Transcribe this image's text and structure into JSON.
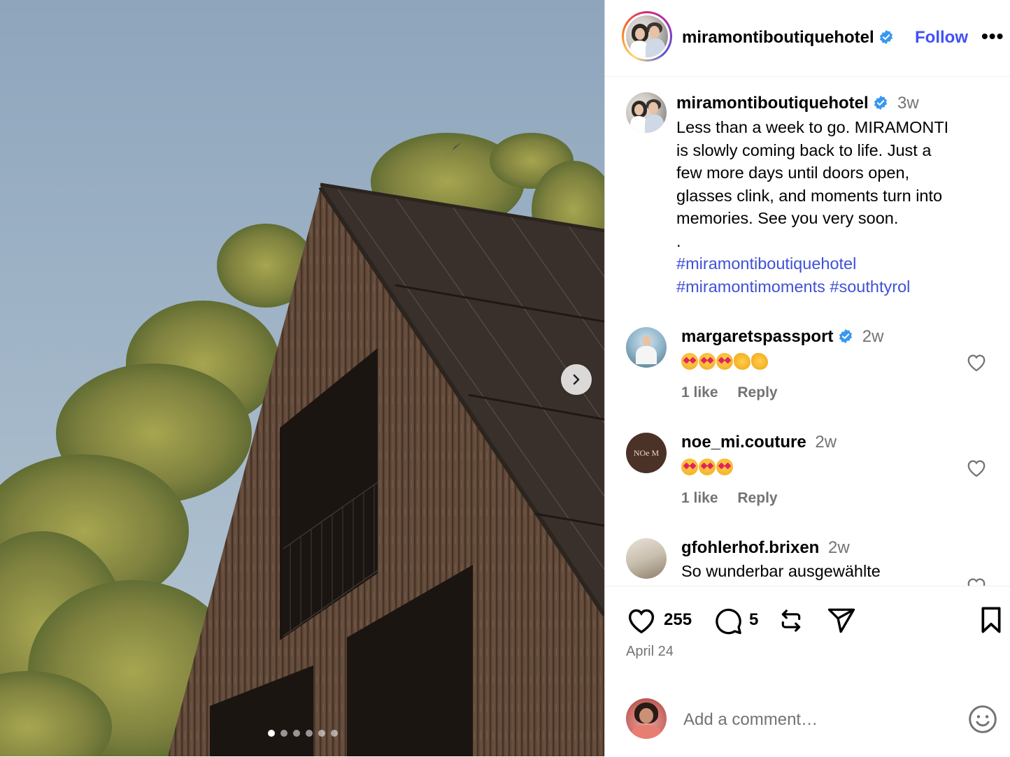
{
  "post": {
    "username": "miramontiboutiquehotel",
    "follow_label": "Follow",
    "more_label": "•••",
    "caption_username": "miramontiboutiquehotel",
    "caption_age": "3w",
    "caption_lines": [
      "Less than a week to go. MIRAMONTI",
      "is slowly coming back to life. Just a",
      "few more days until doors open,",
      "glasses clink, and moments turn into",
      "memories. See you very soon.",
      "."
    ],
    "hashtags": [
      "#miramontiboutiquehotel",
      "#miramontimoments",
      "#southtyrol"
    ],
    "media_dots": 6,
    "media_active_dot": 0
  },
  "comments": [
    {
      "username": "margaretspassport",
      "verified": true,
      "age": "2w",
      "text": "",
      "emoji": [
        "heart-eyes",
        "heart-eyes",
        "heart-eyes",
        "clap",
        "clap"
      ],
      "likes": "1 like",
      "reply": "Reply"
    },
    {
      "username": "noe_mi.couture",
      "verified": false,
      "age": "2w",
      "text": "",
      "emoji": [
        "heart-eyes",
        "heart-eyes",
        "heart-eyes"
      ],
      "likes": "1 like",
      "reply": "Reply"
    },
    {
      "username": "gfohlerhof.brixen",
      "verified": false,
      "age": "2w",
      "text": "So wunderbar ausgewählte"
    }
  ],
  "actions": {
    "likes_count": "255",
    "comments_count": "5",
    "date": "April 24"
  },
  "add_comment": {
    "placeholder": "Add a comment…"
  },
  "colors": {
    "link": "#3f51d6",
    "follow": "#4150f7",
    "muted": "#737373",
    "verified": "#3897f0"
  }
}
